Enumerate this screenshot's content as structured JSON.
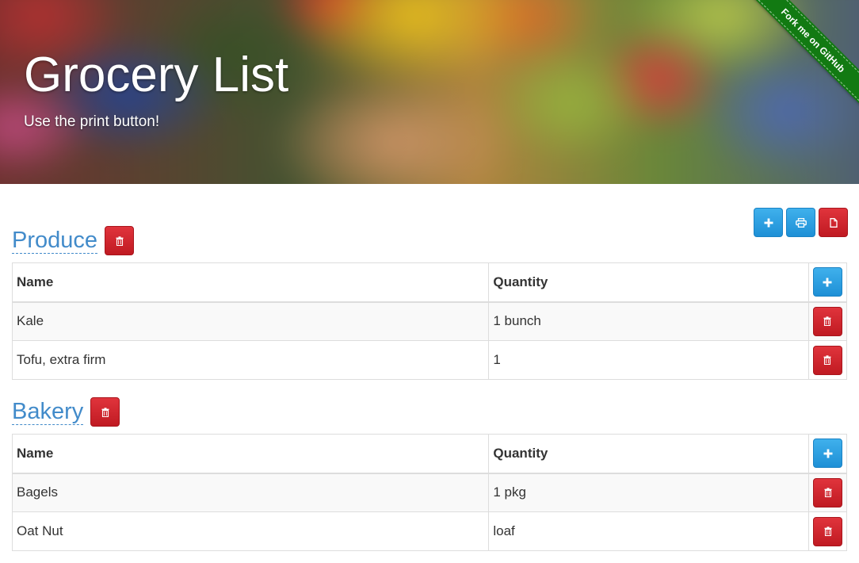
{
  "header": {
    "title": "Grocery List",
    "subtitle": "Use the print button!",
    "ribbon_label": "Fork me on GitHub"
  },
  "toolbar": {
    "add_icon": "plus-icon",
    "print_icon": "printer-icon",
    "export_icon": "document-icon"
  },
  "colors": {
    "primary_blue": "#2a9de2",
    "danger_red": "#d0262e",
    "title_blue": "#428bca",
    "ribbon_green": "#127a12"
  },
  "sections": [
    {
      "title": "Produce",
      "columns": [
        "Name",
        "Quantity"
      ],
      "items": [
        {
          "name": "Kale",
          "quantity": "1 bunch"
        },
        {
          "name": "Tofu, extra firm",
          "quantity": "1"
        }
      ]
    },
    {
      "title": "Bakery",
      "columns": [
        "Name",
        "Quantity"
      ],
      "items": [
        {
          "name": "Bagels",
          "quantity": "1 pkg"
        },
        {
          "name": "Oat Nut",
          "quantity": "loaf"
        }
      ]
    }
  ]
}
